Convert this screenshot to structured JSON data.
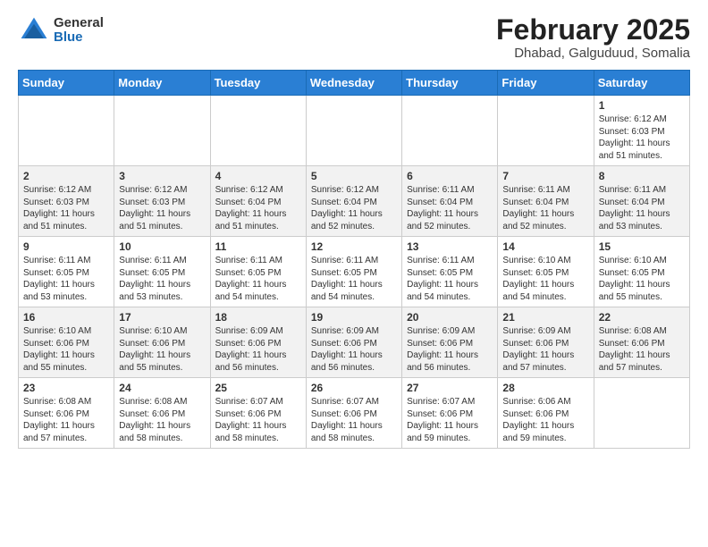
{
  "header": {
    "logo": {
      "general": "General",
      "blue": "Blue"
    },
    "title": "February 2025",
    "location": "Dhabad, Galguduud, Somalia"
  },
  "days_of_week": [
    "Sunday",
    "Monday",
    "Tuesday",
    "Wednesday",
    "Thursday",
    "Friday",
    "Saturday"
  ],
  "weeks": [
    [
      {
        "day": "",
        "info": ""
      },
      {
        "day": "",
        "info": ""
      },
      {
        "day": "",
        "info": ""
      },
      {
        "day": "",
        "info": ""
      },
      {
        "day": "",
        "info": ""
      },
      {
        "day": "",
        "info": ""
      },
      {
        "day": "1",
        "info": "Sunrise: 6:12 AM\nSunset: 6:03 PM\nDaylight: 11 hours and 51 minutes."
      }
    ],
    [
      {
        "day": "2",
        "info": "Sunrise: 6:12 AM\nSunset: 6:03 PM\nDaylight: 11 hours and 51 minutes."
      },
      {
        "day": "3",
        "info": "Sunrise: 6:12 AM\nSunset: 6:03 PM\nDaylight: 11 hours and 51 minutes."
      },
      {
        "day": "4",
        "info": "Sunrise: 6:12 AM\nSunset: 6:04 PM\nDaylight: 11 hours and 51 minutes."
      },
      {
        "day": "5",
        "info": "Sunrise: 6:12 AM\nSunset: 6:04 PM\nDaylight: 11 hours and 52 minutes."
      },
      {
        "day": "6",
        "info": "Sunrise: 6:11 AM\nSunset: 6:04 PM\nDaylight: 11 hours and 52 minutes."
      },
      {
        "day": "7",
        "info": "Sunrise: 6:11 AM\nSunset: 6:04 PM\nDaylight: 11 hours and 52 minutes."
      },
      {
        "day": "8",
        "info": "Sunrise: 6:11 AM\nSunset: 6:04 PM\nDaylight: 11 hours and 53 minutes."
      }
    ],
    [
      {
        "day": "9",
        "info": "Sunrise: 6:11 AM\nSunset: 6:05 PM\nDaylight: 11 hours and 53 minutes."
      },
      {
        "day": "10",
        "info": "Sunrise: 6:11 AM\nSunset: 6:05 PM\nDaylight: 11 hours and 53 minutes."
      },
      {
        "day": "11",
        "info": "Sunrise: 6:11 AM\nSunset: 6:05 PM\nDaylight: 11 hours and 54 minutes."
      },
      {
        "day": "12",
        "info": "Sunrise: 6:11 AM\nSunset: 6:05 PM\nDaylight: 11 hours and 54 minutes."
      },
      {
        "day": "13",
        "info": "Sunrise: 6:11 AM\nSunset: 6:05 PM\nDaylight: 11 hours and 54 minutes."
      },
      {
        "day": "14",
        "info": "Sunrise: 6:10 AM\nSunset: 6:05 PM\nDaylight: 11 hours and 54 minutes."
      },
      {
        "day": "15",
        "info": "Sunrise: 6:10 AM\nSunset: 6:05 PM\nDaylight: 11 hours and 55 minutes."
      }
    ],
    [
      {
        "day": "16",
        "info": "Sunrise: 6:10 AM\nSunset: 6:06 PM\nDaylight: 11 hours and 55 minutes."
      },
      {
        "day": "17",
        "info": "Sunrise: 6:10 AM\nSunset: 6:06 PM\nDaylight: 11 hours and 55 minutes."
      },
      {
        "day": "18",
        "info": "Sunrise: 6:09 AM\nSunset: 6:06 PM\nDaylight: 11 hours and 56 minutes."
      },
      {
        "day": "19",
        "info": "Sunrise: 6:09 AM\nSunset: 6:06 PM\nDaylight: 11 hours and 56 minutes."
      },
      {
        "day": "20",
        "info": "Sunrise: 6:09 AM\nSunset: 6:06 PM\nDaylight: 11 hours and 56 minutes."
      },
      {
        "day": "21",
        "info": "Sunrise: 6:09 AM\nSunset: 6:06 PM\nDaylight: 11 hours and 57 minutes."
      },
      {
        "day": "22",
        "info": "Sunrise: 6:08 AM\nSunset: 6:06 PM\nDaylight: 11 hours and 57 minutes."
      }
    ],
    [
      {
        "day": "23",
        "info": "Sunrise: 6:08 AM\nSunset: 6:06 PM\nDaylight: 11 hours and 57 minutes."
      },
      {
        "day": "24",
        "info": "Sunrise: 6:08 AM\nSunset: 6:06 PM\nDaylight: 11 hours and 58 minutes."
      },
      {
        "day": "25",
        "info": "Sunrise: 6:07 AM\nSunset: 6:06 PM\nDaylight: 11 hours and 58 minutes."
      },
      {
        "day": "26",
        "info": "Sunrise: 6:07 AM\nSunset: 6:06 PM\nDaylight: 11 hours and 58 minutes."
      },
      {
        "day": "27",
        "info": "Sunrise: 6:07 AM\nSunset: 6:06 PM\nDaylight: 11 hours and 59 minutes."
      },
      {
        "day": "28",
        "info": "Sunrise: 6:06 AM\nSunset: 6:06 PM\nDaylight: 11 hours and 59 minutes."
      },
      {
        "day": "",
        "info": ""
      }
    ]
  ]
}
